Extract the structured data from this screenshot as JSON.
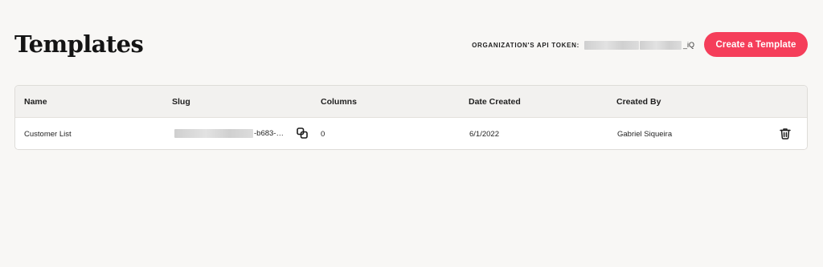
{
  "page": {
    "title": "Templates"
  },
  "header": {
    "token_label": "ORGANIZATION'S API TOKEN:",
    "token_suffix": "_iQ",
    "create_button_label": "Create a Template"
  },
  "table": {
    "columns": [
      "Name",
      "Slug",
      "Columns",
      "Date Created",
      "Created By"
    ],
    "rows": [
      {
        "name": "Customer List",
        "slug_suffix": "-b683-…",
        "columns": "0",
        "date_created": "6/1/2022",
        "created_by": "Gabriel Siqueira"
      }
    ]
  },
  "icons": {
    "copy": "copy-icon",
    "delete": "trash-icon"
  },
  "colors": {
    "accent": "#f53e5a",
    "background": "#f8f7f5",
    "table_header": "#f2f1ef"
  }
}
